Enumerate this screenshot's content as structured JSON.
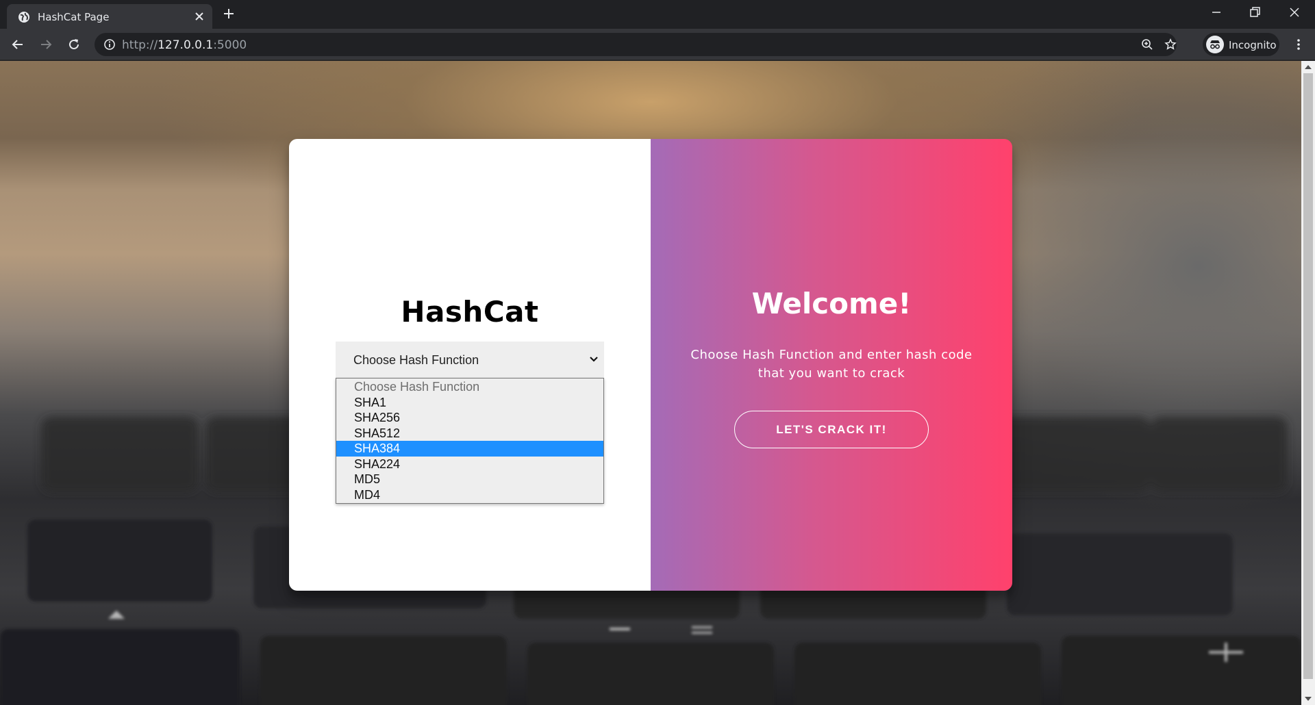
{
  "browser": {
    "tab_title": "HashCat Page",
    "url_scheme": "http://",
    "url_host": "127.0.0.1",
    "url_port": ":5000",
    "profile_label": "Incognito"
  },
  "page": {
    "brand": "HashCat",
    "select": {
      "current_value": "Choose Hash Function",
      "options": [
        "Choose Hash Function",
        "SHA1",
        "SHA256",
        "SHA512",
        "SHA384",
        "SHA224",
        "MD5",
        "MD4"
      ],
      "highlighted": "SHA384"
    },
    "welcome": {
      "title": "Welcome!",
      "subtitle": "Choose Hash Function and enter hash code that you want to crack",
      "button_label": "LET'S CRACK IT!"
    }
  },
  "colors": {
    "gradient_start": "#a46bb7",
    "gradient_end": "#ff416c",
    "highlight": "#1e90ff"
  }
}
